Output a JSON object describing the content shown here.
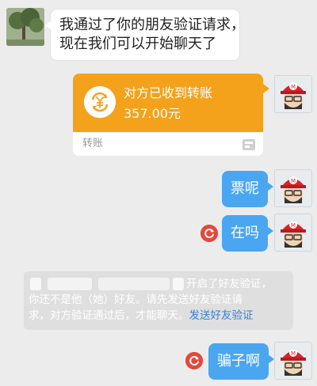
{
  "messages": {
    "incoming_1": {
      "line1": "我通过了你的朋友验证请求，",
      "line2": "现在我们可以开始聊天了"
    },
    "transfer_card": {
      "title": "对方已收到转账",
      "amount": "357.00元",
      "footer_label": "转账"
    },
    "outgoing_1": "票呢",
    "outgoing_2": "在吗",
    "outgoing_3": "骗子啊"
  },
  "system_notice": {
    "line1_tail": "开启了好友验证，",
    "line2": "你还不是他（她）好友。请先发送好友验证请",
    "line3_prefix": "求，对方验证通过后，才能聊天。",
    "link": "发送好友验证"
  },
  "icons": {
    "transfer": "yuan-refresh-icon",
    "resend": "resend-icon",
    "footer_app": "transfer-app-icon"
  },
  "colors": {
    "transfer_orange": "#f4a21b",
    "bubble_blue": "#4aa6f1",
    "link_blue": "#3b7fd1",
    "error_red": "#e5483a"
  }
}
